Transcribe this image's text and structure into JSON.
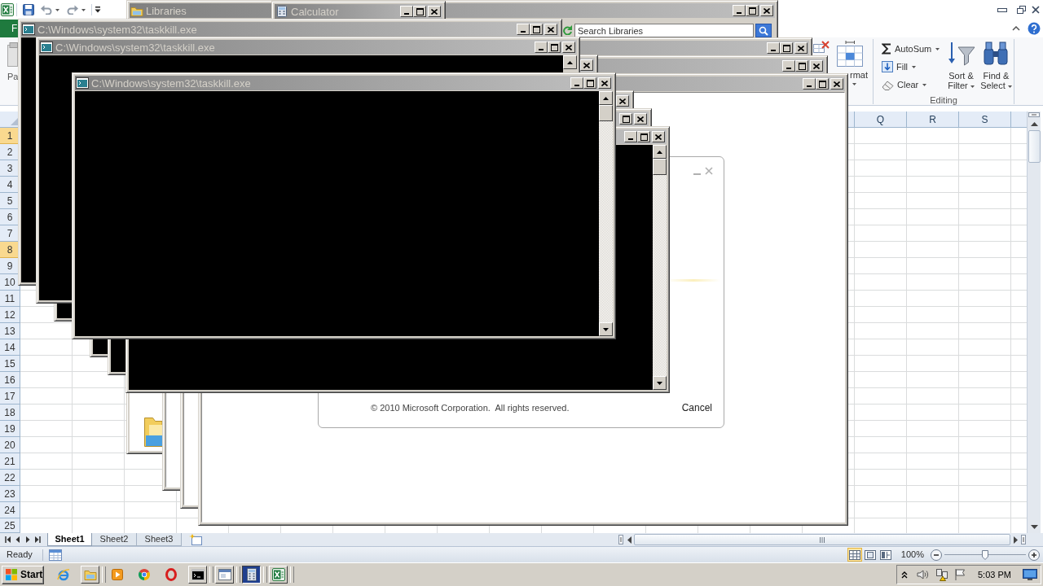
{
  "excel": {
    "file_tab": "F",
    "ribbon": {
      "paste": "Pa",
      "format": "rmat",
      "autosum": "AutoSum",
      "fill": "Fill",
      "clear": "Clear",
      "sort_filter": "Sort & Filter",
      "find_select": "Find & Select",
      "group_label": "Editing"
    },
    "columns": [
      {
        "label": "Q"
      },
      {
        "label": "R"
      },
      {
        "label": "S"
      }
    ],
    "rows": [
      {
        "label": "1",
        "selected": true
      },
      {
        "label": "2",
        "selected": false
      },
      {
        "label": "3",
        "selected": false
      },
      {
        "label": "4",
        "selected": false
      },
      {
        "label": "5",
        "selected": false
      },
      {
        "label": "6",
        "selected": false
      },
      {
        "label": "7",
        "selected": false
      },
      {
        "label": "8",
        "selected": true
      },
      {
        "label": "9",
        "selected": false
      },
      {
        "label": "10",
        "selected": false
      },
      {
        "label": "11",
        "selected": false
      },
      {
        "label": "12",
        "selected": false
      },
      {
        "label": "13",
        "selected": false
      },
      {
        "label": "14",
        "selected": false
      },
      {
        "label": "15",
        "selected": false
      },
      {
        "label": "16",
        "selected": false
      },
      {
        "label": "17",
        "selected": false
      },
      {
        "label": "18",
        "selected": false
      },
      {
        "label": "19",
        "selected": false
      },
      {
        "label": "20",
        "selected": false
      },
      {
        "label": "21",
        "selected": false
      },
      {
        "label": "22",
        "selected": false
      },
      {
        "label": "23",
        "selected": false
      },
      {
        "label": "24",
        "selected": false
      },
      {
        "label": "25",
        "selected": false
      }
    ],
    "sheet_tabs": [
      {
        "label": "Sheet1",
        "selected": true
      },
      {
        "label": "Sheet2",
        "selected": false
      },
      {
        "label": "Sheet3",
        "selected": false
      }
    ],
    "status_bar": {
      "text": "Ready",
      "views": [
        {
          "kind": "normal",
          "selected": true
        },
        {
          "kind": "layout",
          "selected": false
        },
        {
          "kind": "pagebreak",
          "selected": false
        }
      ],
      "zoom": "100%",
      "zoom_slider": {
        "level": 0.5
      }
    }
  },
  "windows": [
    {
      "kind": "explorer",
      "title": "Libraries",
      "search": {
        "placeholder": "Search Libraries"
      }
    },
    {
      "kind": "calculator",
      "title": "Calculator"
    },
    {
      "kind": "blank"
    },
    {
      "kind": "blank"
    },
    {
      "kind": "blank"
    },
    {
      "kind": "splash",
      "copyright": "© 2010 Microsoft Corporation.  All rights reserved.",
      "cancel": "Cancel"
    },
    {
      "kind": "console"
    },
    {
      "kind": "console",
      "title": "C:\\Windows\\system32\\taskkill.exe"
    },
    {
      "kind": "console",
      "title": "C:\\Windows\\system32\\taskkill.exe"
    },
    {
      "kind": "console"
    },
    {
      "kind": "console"
    },
    {
      "kind": "console"
    },
    {
      "kind": "console",
      "title": "C:\\Windows\\system32\\taskkill.exe"
    }
  ],
  "taskbar": {
    "start": "Start",
    "buttons": [
      {
        "kind": "swoosh",
        "running": false,
        "selected": false
      },
      {
        "kind": "folder",
        "running": true,
        "selected": false
      },
      {
        "kind": "play",
        "running": false,
        "selected": false
      },
      {
        "kind": "segments",
        "running": false,
        "selected": false
      },
      {
        "kind": "ring",
        "running": false,
        "selected": false
      },
      {
        "kind": "terminal",
        "running": true,
        "selected": false
      },
      {
        "kind": "window",
        "running": true,
        "selected": false
      },
      {
        "kind": "calculator",
        "running": true,
        "selected": true
      },
      {
        "kind": "xtile",
        "running": true,
        "selected": false
      }
    ],
    "clock": "5:03 PM"
  }
}
